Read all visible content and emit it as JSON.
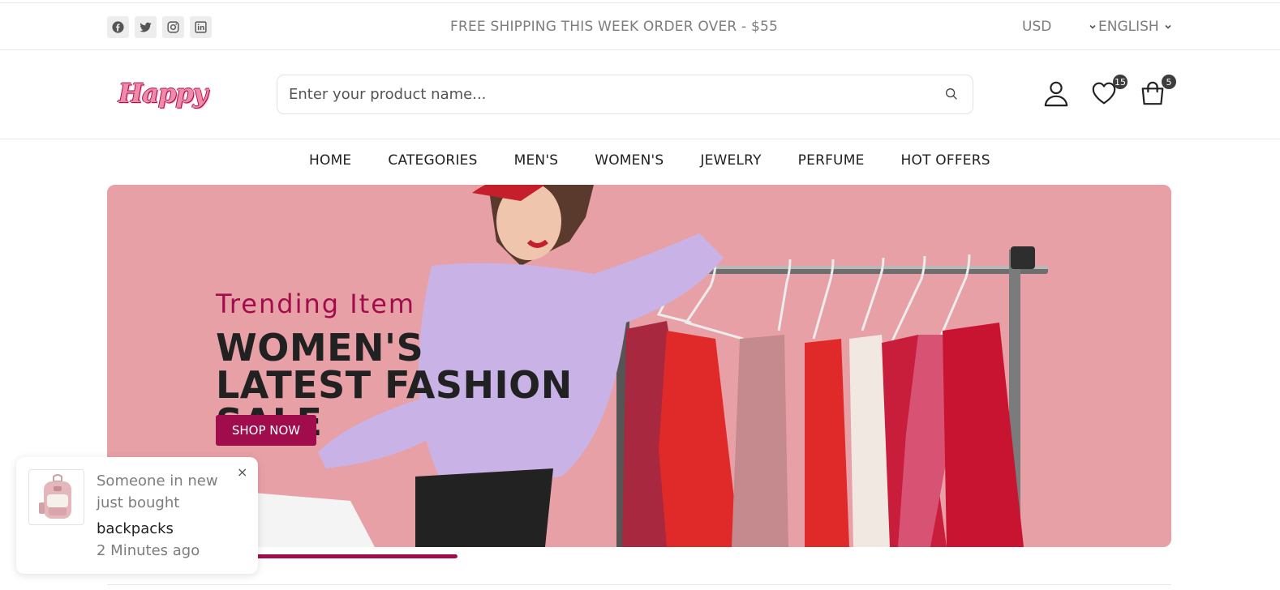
{
  "topbar": {
    "socials": [
      "facebook-icon",
      "twitter-icon",
      "instagram-icon",
      "linkedin-icon"
    ],
    "promo": "FREE SHIPPING THIS WEEK ORDER OVER - $55",
    "currency": "USD",
    "language": "ENGLISH"
  },
  "header": {
    "logo": "Happy",
    "search_placeholder": "Enter your product name...",
    "wishlist_count": "15",
    "cart_count": "5"
  },
  "nav": {
    "items": [
      "HOME",
      "CATEGORIES",
      "MEN'S",
      "WOMEN'S",
      "JEWELRY",
      "PERFUME",
      "HOT OFFERS"
    ]
  },
  "banner": {
    "subtitle": "Trending Item",
    "title": "WOMEN'S LATEST FASHION SALE",
    "button": "SHOP NOW",
    "slider_progress": 0.33
  },
  "toast": {
    "message": "Someone in new just bought",
    "product": "backpacks",
    "time": "2 Minutes ago",
    "close": "×"
  },
  "colors": {
    "accent": "#a10d4c",
    "banner_bg": "#e8a0a7",
    "muted": "#7d7d7d"
  }
}
